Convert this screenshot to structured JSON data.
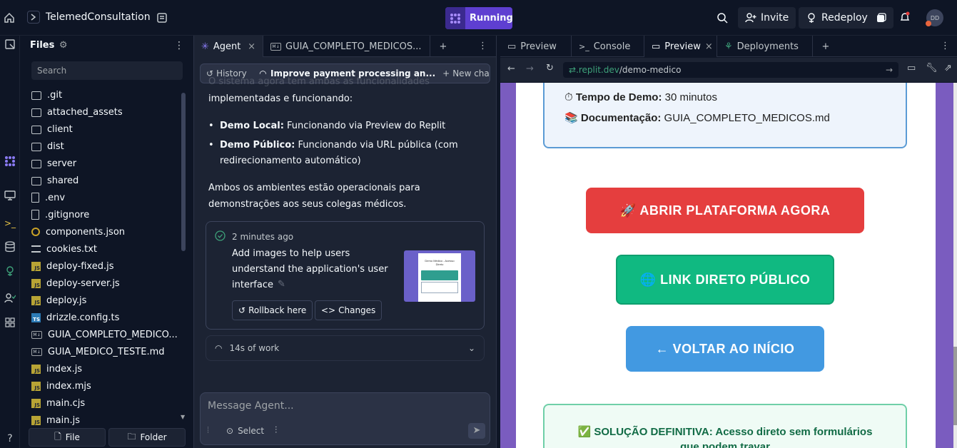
{
  "topbar": {
    "project_title": "TelemedConsultation",
    "running_label": "Running",
    "invite_label": "Invite",
    "redeploy_label": "Redeploy",
    "avatar_initials": "DD"
  },
  "files": {
    "title": "Files",
    "search_placeholder": "Search",
    "items": [
      {
        "name": ".git",
        "type": "folder"
      },
      {
        "name": "attached_assets",
        "type": "folder"
      },
      {
        "name": "client",
        "type": "folder"
      },
      {
        "name": "dist",
        "type": "folder"
      },
      {
        "name": "server",
        "type": "folder"
      },
      {
        "name": "shared",
        "type": "folder"
      },
      {
        "name": ".env",
        "type": "file"
      },
      {
        "name": ".gitignore",
        "type": "file"
      },
      {
        "name": "components.json",
        "type": "json"
      },
      {
        "name": "cookies.txt",
        "type": "lines"
      },
      {
        "name": "deploy-fixed.js",
        "type": "js"
      },
      {
        "name": "deploy-server.js",
        "type": "js"
      },
      {
        "name": "deploy.js",
        "type": "js"
      },
      {
        "name": "drizzle.config.ts",
        "type": "ts"
      },
      {
        "name": "GUIA_COMPLETO_MEDICO...",
        "type": "md"
      },
      {
        "name": "GUIA_MEDICO_TESTE.md",
        "type": "md"
      },
      {
        "name": "index.js",
        "type": "js"
      },
      {
        "name": "index.mjs",
        "type": "js"
      },
      {
        "name": "main.cjs",
        "type": "js"
      },
      {
        "name": "main.js",
        "type": "js"
      }
    ],
    "file_button": "File",
    "folder_button": "Folder"
  },
  "agent": {
    "tabs": [
      "Agent",
      "GUIA_COMPLETO_MEDICOS..."
    ],
    "md_badge": "M↓",
    "history_label": "History",
    "current_chat": "Improve payment processing an...",
    "new_chat_label": "New chat",
    "partial_line": "O sistema agora tem ambas as funcionalidades",
    "para1": "implementadas e funcionando:",
    "bullet1_bold": "Demo Local:",
    "bullet1_text": " Funcionando via Preview do Replit",
    "bullet2_bold": "Demo Público:",
    "bullet2_text_a": " Funcionando via URL pública (com",
    "bullet2_text_b": "redirecionamento automático)",
    "para2_a": "Ambos os ambientes estão operacionais para",
    "para2_b": "demonstrações aos seus colegas médicos.",
    "card_time": "2 minutes ago",
    "card_text_a": "Add images to help users",
    "card_text_b": "understand the application's user",
    "card_text_c": "interface",
    "rollback_label": "Rollback here",
    "changes_label": "Changes",
    "thumb_title": "Demo Médico - Acesso Direto",
    "work_label": "14s of work",
    "message_placeholder": "Message Agent...",
    "select_label": "Select"
  },
  "preview": {
    "tabs": [
      "Preview",
      "Console",
      "Preview",
      "Deployments"
    ],
    "url_domain": ".replit.dev",
    "url_path": "/demo-medico",
    "tempo_label": "Tempo de Demo:",
    "tempo_value": " 30 minutos",
    "doc_label": "Documentação:",
    "doc_value": " GUIA_COMPLETO_MEDICOS.md",
    "btn_abrir": "🚀 ABRIR PLATAFORMA AGORA",
    "btn_link": "🌐 LINK DIRETO PÚBLICO",
    "btn_voltar": "← VOLTAR AO INÍCIO",
    "solution_line1": "✅ SOLUÇÃO DEFINITIVA: Acesso direto sem formulários",
    "solution_line2": "que podem travar",
    "colors": {
      "abrir": "#e53e3e",
      "link": "#10b981",
      "voltar": "#4299e1"
    }
  }
}
